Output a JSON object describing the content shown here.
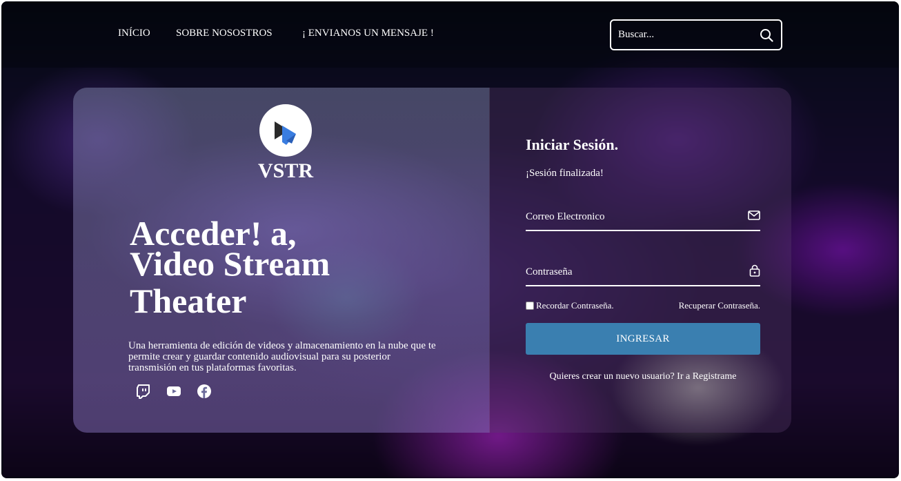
{
  "nav": {
    "items": [
      "INÍCIO",
      "SOBRE NOSOSTROS",
      "¡ ENVIANOS UN MENSAJE !"
    ]
  },
  "search": {
    "placeholder": "Buscar...",
    "icon": "search-icon"
  },
  "brand": {
    "name": "VSTR",
    "logo_icon": "play-icon"
  },
  "hero": {
    "headline_line1": "Acceder! a,",
    "headline_line2": "Video Stream",
    "headline_line3": "Theater",
    "description": "Una herramienta de edición de videos y almacenamiento en la nube que te permite crear y guardar contenido audiovisual para su posterior transmisión en tus plataformas favoritas.",
    "social": [
      "twitch-icon",
      "youtube-icon",
      "facebook-icon"
    ]
  },
  "login": {
    "title": "Iniciar Sesión.",
    "message": "¡Sesión finalizada!",
    "email_placeholder": "Correo Electronico",
    "email_icon": "mail-icon",
    "password_placeholder": "Contraseña",
    "password_icon": "lock-icon",
    "remember_label": "Recordar Contraseña.",
    "recover_label": "Recuperar Contraseña.",
    "submit_label": "INGRESAR",
    "register_text": "Quieres crear un nuevo usuario? Ir a Registrame"
  },
  "colors": {
    "button": "#3a7fb0",
    "logo_blue": "#2f6bd1"
  }
}
